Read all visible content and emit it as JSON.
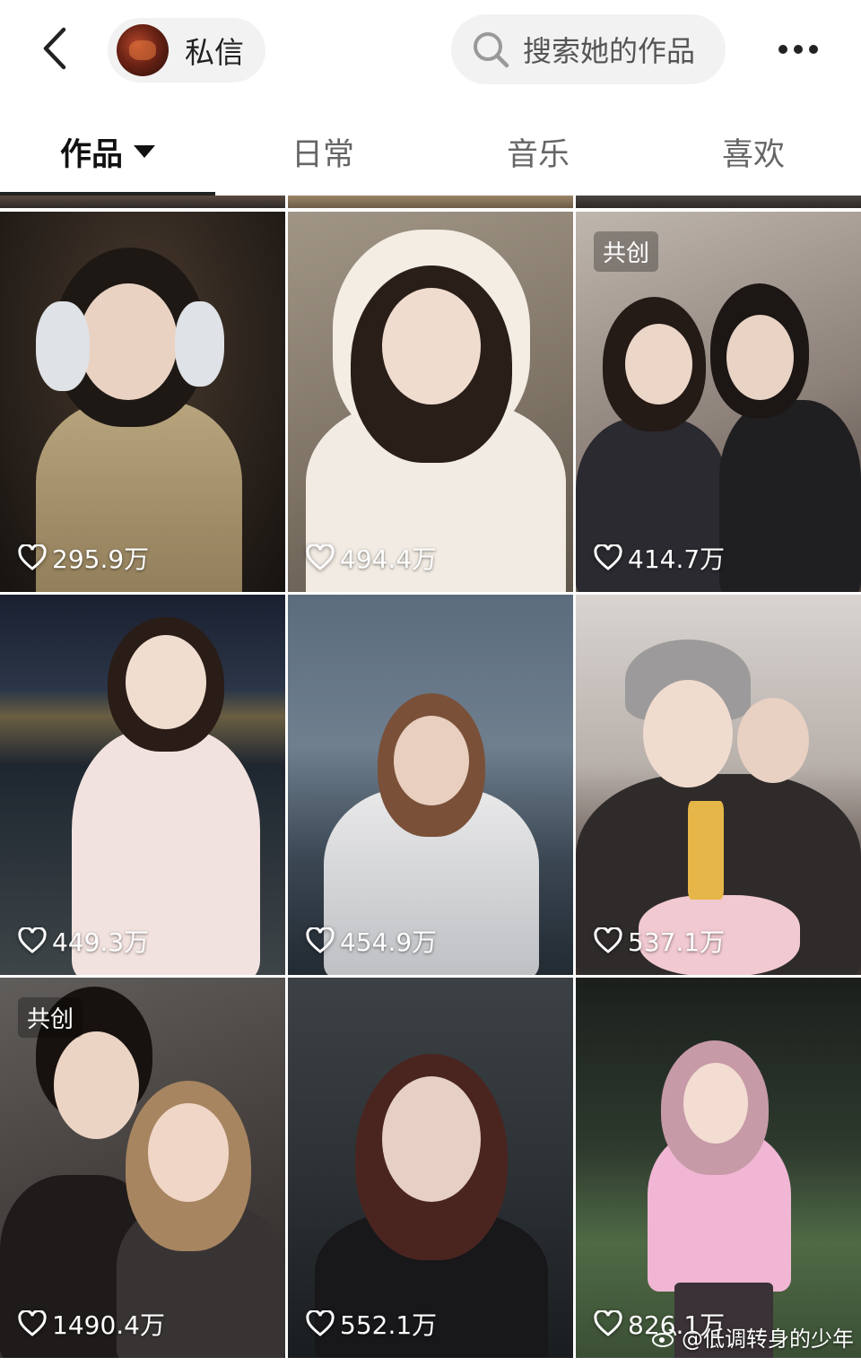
{
  "header": {
    "dm_label": "私信",
    "search_placeholder": "搜索她的作品"
  },
  "tabs": [
    {
      "label": "作品",
      "active": true
    },
    {
      "label": "日常",
      "active": false
    },
    {
      "label": "音乐",
      "active": false
    },
    {
      "label": "喜欢",
      "active": false
    }
  ],
  "videos": [
    {
      "likes": "295.9万",
      "badge": ""
    },
    {
      "likes": "494.4万",
      "badge": ""
    },
    {
      "likes": "414.7万",
      "badge": "共创"
    },
    {
      "likes": "449.3万",
      "badge": ""
    },
    {
      "likes": "454.9万",
      "badge": ""
    },
    {
      "likes": "537.1万",
      "badge": ""
    },
    {
      "likes": "1490.4万",
      "badge": "共创"
    },
    {
      "likes": "552.1万",
      "badge": ""
    },
    {
      "likes": "826.1万",
      "badge": ""
    }
  ],
  "watermark": "@低调转身的少年",
  "colors": {
    "accent": "#111111",
    "pill_bg": "#f2f2f2"
  }
}
